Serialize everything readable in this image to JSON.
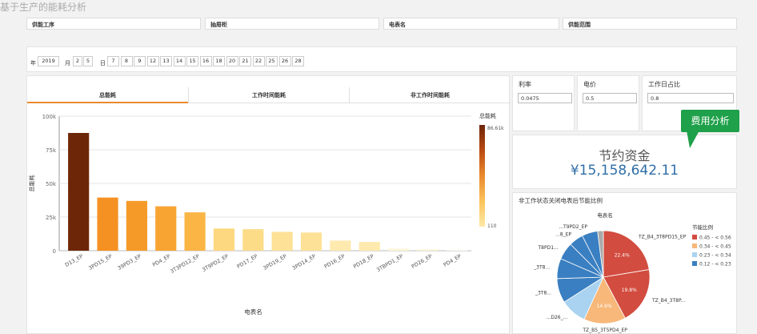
{
  "app": {
    "title": "基于生产的能耗分析"
  },
  "filters": [
    {
      "label": "供能工序"
    },
    {
      "label": "抽屉柜"
    },
    {
      "label": "电表名"
    },
    {
      "label": "供能范围"
    }
  ],
  "date_bar": {
    "year_label": "年",
    "year_value": "2019",
    "month_label": "月",
    "months": [
      "2",
      "5"
    ],
    "day_label": "日",
    "days": [
      "7",
      "8",
      "9",
      "12",
      "13",
      "14",
      "15",
      "16",
      "18",
      "20",
      "21",
      "22",
      "25",
      "26",
      "28"
    ]
  },
  "tabs": [
    {
      "label": "总能耗",
      "active": true
    },
    {
      "label": "工作时间能耗",
      "active": false
    },
    {
      "label": "非工作时间能耗",
      "active": false
    }
  ],
  "kpis": {
    "rate": {
      "label": "利率",
      "value": "0.0475"
    },
    "price": {
      "label": "电价",
      "value": "0.5"
    },
    "workday": {
      "label": "工作日占比",
      "value": "0.8"
    }
  },
  "callout": {
    "label": "费用分析"
  },
  "savings": {
    "title": "节约资金",
    "value": "¥15,158,642.11"
  },
  "chart_data": [
    {
      "type": "bar",
      "xlabel": "电表名",
      "ylabel": "总能耗",
      "ylim": [
        0,
        100000
      ],
      "yticks": [
        "0",
        "25k",
        "50k",
        "75k",
        "100k"
      ],
      "grid": true,
      "legend": {
        "title": "总能耗",
        "max_label": "86.61k",
        "min_label": "110",
        "placement": "right",
        "colors": [
          "#6e2608",
          "#b94a12",
          "#e98a2e",
          "#fbc35a",
          "#fde9a8"
        ]
      },
      "categories": [
        "D13_EP",
        "3PD15_EP",
        "39PD3_EP",
        "PD4_EP",
        "3T3PD12_EP",
        "3T9PD2_EP",
        "PD17_EP",
        "3PD19_EP",
        "3PD14_EP",
        "PD16_EP",
        "PD18_EP",
        "3TBPD1_EP",
        "PD26_EP",
        "PD4_EP"
      ],
      "values": [
        87500,
        39500,
        37000,
        33000,
        28500,
        16500,
        16000,
        14000,
        13500,
        7500,
        6500,
        1500,
        1000,
        500
      ],
      "colors": [
        "#6e2608",
        "#f59122",
        "#f59a28",
        "#f8a433",
        "#fab545",
        "#fdd880",
        "#fddc88",
        "#fde196",
        "#fde196",
        "#feeaae",
        "#feeaae",
        "#fff5d6",
        "#fff5d6",
        "#fffaea"
      ]
    },
    {
      "type": "pie",
      "title": "非工作状态关闭电表后节能比例",
      "subtitle": "电表名",
      "legend": {
        "title": "节能比例",
        "placement": "right",
        "entries": [
          {
            "label": "0.45 - < 0.56",
            "color": "#d24c3f"
          },
          {
            "label": "0.34 - < 0.45",
            "color": "#f7b87a"
          },
          {
            "label": "0.23 - < 0.34",
            "color": "#a9d3f0"
          },
          {
            "label": "0.12 - < 0.23",
            "color": "#3a7fc1"
          }
        ]
      },
      "slices": [
        {
          "label": "TZ_B4_3T8PD15_EP",
          "value": 22.4,
          "color": "#d24c3f",
          "pct_label": "22.4%"
        },
        {
          "label": "TZ_B4_3T8P...",
          "value": 19.8,
          "color": "#d24c3f",
          "pct_label": "19.8%"
        },
        {
          "label": "TZ_B5_3T5PD4_EP",
          "value": 14.6,
          "color": "#f7b87a",
          "pct_label": "14.6%"
        },
        {
          "label": "...D26_...",
          "value": 9.2,
          "color": "#a9d3f0",
          "pct_label": ""
        },
        {
          "label": "_3T8...",
          "value": 8.5,
          "color": "#3a7fc1",
          "pct_label": ""
        },
        {
          "label": "_3T8...",
          "value": 7.0,
          "color": "#3a7fc1",
          "pct_label": ""
        },
        {
          "label": "T8PD1...",
          "value": 6.0,
          "color": "#3a7fc1",
          "pct_label": ""
        },
        {
          "label": "...8_EP",
          "value": 5.0,
          "color": "#3a7fc1",
          "pct_label": ""
        },
        {
          "label": "...T9PD2_EP",
          "value": 5.5,
          "color": "#3a7fc1",
          "pct_label": ""
        },
        {
          "label": "",
          "value": 2.0,
          "color": "#aaaaaa",
          "pct_label": ""
        }
      ]
    }
  ]
}
